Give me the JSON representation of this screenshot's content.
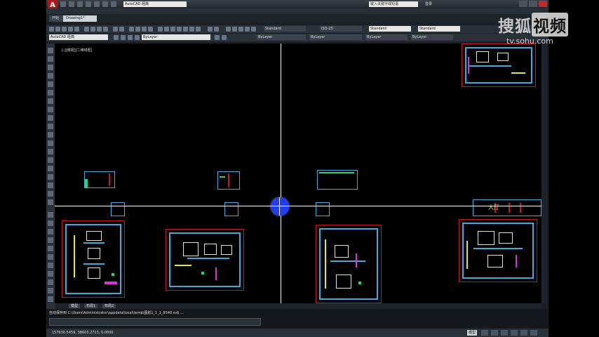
{
  "app": {
    "logo_letter": "A",
    "workspace_value": "AutoCAD 经典",
    "search_placeholder": "键入关键字或短语",
    "signin_label": "登录"
  },
  "file_tabs": [
    {
      "label": "开始"
    },
    {
      "label": "Drawing1*"
    }
  ],
  "toolbar": {
    "workspace_combo": "AutoCAD 经典",
    "layer_combo": "ByLayer",
    "textstyle_combo": "Standard",
    "dimstyle_combo": "ISO-25",
    "tablestyle_combo": "Standard",
    "linetype_combo": "ByLayer",
    "lineweight_combo": "ByLayer",
    "color_combo": "ByLayer"
  },
  "viewport": {
    "label": "[-][俯视][二维线框]"
  },
  "cad_text": "大厅",
  "layout_tabs": [
    {
      "label": "模型"
    },
    {
      "label": "布局1"
    },
    {
      "label": "布局2"
    }
  ],
  "command": {
    "history": "自动保存到 C:\\Users\\Administrator\\appdata\\local\\temp\\图纸1_1_1_5540.sv$ ...",
    "input_value": ""
  },
  "status": {
    "coordinates": "157630.5459, 38603.2713, 0.0000",
    "model_label": "模型"
  },
  "watermark": {
    "brand_part1": "搜狐",
    "brand_part2": "视频",
    "url": "tv.sohu.com"
  },
  "colors": {
    "canvas_bg": "#000000",
    "wall_blue": "#3fa9e0",
    "frame_red": "#c0182a",
    "accent_yellow": "#e6e631",
    "accent_magenta": "#d437d4",
    "accent_green": "#2bd66c",
    "cursor_blue": "#1f3cff"
  }
}
